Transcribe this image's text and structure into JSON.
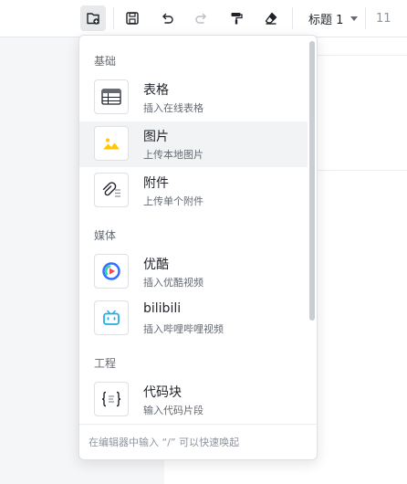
{
  "toolbar": {
    "icons": [
      "insert-block-icon",
      "save-icon",
      "undo-icon",
      "redo-icon",
      "format-painter-icon",
      "eraser-icon"
    ],
    "heading_label": "标题 1",
    "font_size_label": "11"
  },
  "menu": {
    "sections": [
      {
        "title": "基础"
      },
      {
        "title": "媒体"
      },
      {
        "title": "工程"
      }
    ],
    "items": [
      {
        "title": "表格",
        "desc": "插入在线表格",
        "icon": "table-icon"
      },
      {
        "title": "图片",
        "desc": "上传本地图片",
        "icon": "image-icon"
      },
      {
        "title": "附件",
        "desc": "上传单个附件",
        "icon": "attachment-icon"
      },
      {
        "title": "优酷",
        "desc": "插入优酷视频",
        "icon": "youku-icon"
      },
      {
        "title": "bilibili",
        "desc": "插入哔哩哔哩视频",
        "icon": "bilibili-icon"
      },
      {
        "title": "代码块",
        "desc": "输入代码片段",
        "icon": "code-block-icon"
      }
    ],
    "footer_hint": "在编辑器中输入 “/” 可以快速唤起"
  },
  "colors": {
    "accent_blue": "#3370ff",
    "image_yellow": "#ffc60a",
    "bilibili_blue": "#23ade5",
    "youku_red": "#f54a45"
  }
}
